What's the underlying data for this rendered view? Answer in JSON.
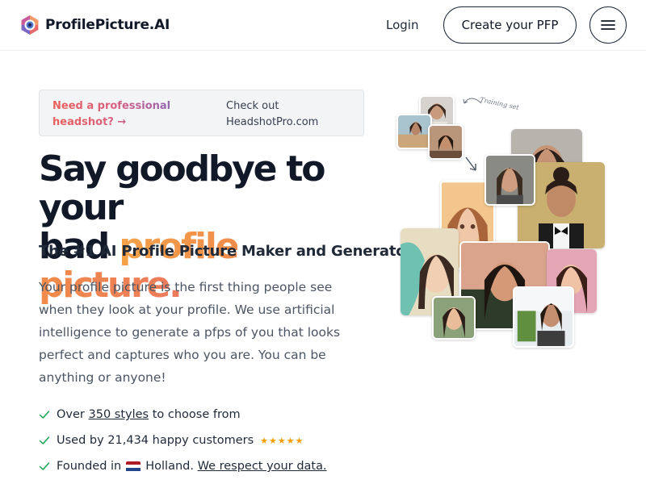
{
  "brand": {
    "name": "ProfilePicture.AI",
    "logo_icon": "camera-lens-icon"
  },
  "nav": {
    "login_label": "Login",
    "cta_label": "Create your PFP",
    "menu_icon": "hamburger-icon"
  },
  "banner": {
    "promo_text": "Need a professional headshot? →",
    "secondary_text": "Check out HeadshotPro.com"
  },
  "hero": {
    "title_line1": "Say goodbye to your",
    "title_prefix": "bad",
    "title_accent": "profile picture.",
    "subtitle": "The #1 AI Profile Picture Maker and Generator",
    "description": "Your profile picture is the first thing people see when they look at your profile. We use artificial intelligence to generate a pfps of you that looks perfect and captures who you are. You can be anything or anyone!"
  },
  "features": {
    "item1_prefix": "Over",
    "item1_link": "350 styles",
    "item1_suffix": "to choose from",
    "item2_text": "Used by 21,434 happy customers",
    "item2_stars": "★★★★★",
    "item3_prefix": "Founded in",
    "item3_country": "Holland.",
    "item3_link": "We respect your data."
  },
  "collage": {
    "training_label": "Training set",
    "icons": [
      "arrow-curved-icon",
      "arrow-down-icon",
      "check-icon",
      "netherlands-flag-icon"
    ]
  },
  "colors": {
    "accent_orange": "#f08a4b",
    "promo_red": "#e8605a",
    "promo_purple": "#7b68c4",
    "star": "#f59e0b",
    "check": "#16a34a"
  }
}
